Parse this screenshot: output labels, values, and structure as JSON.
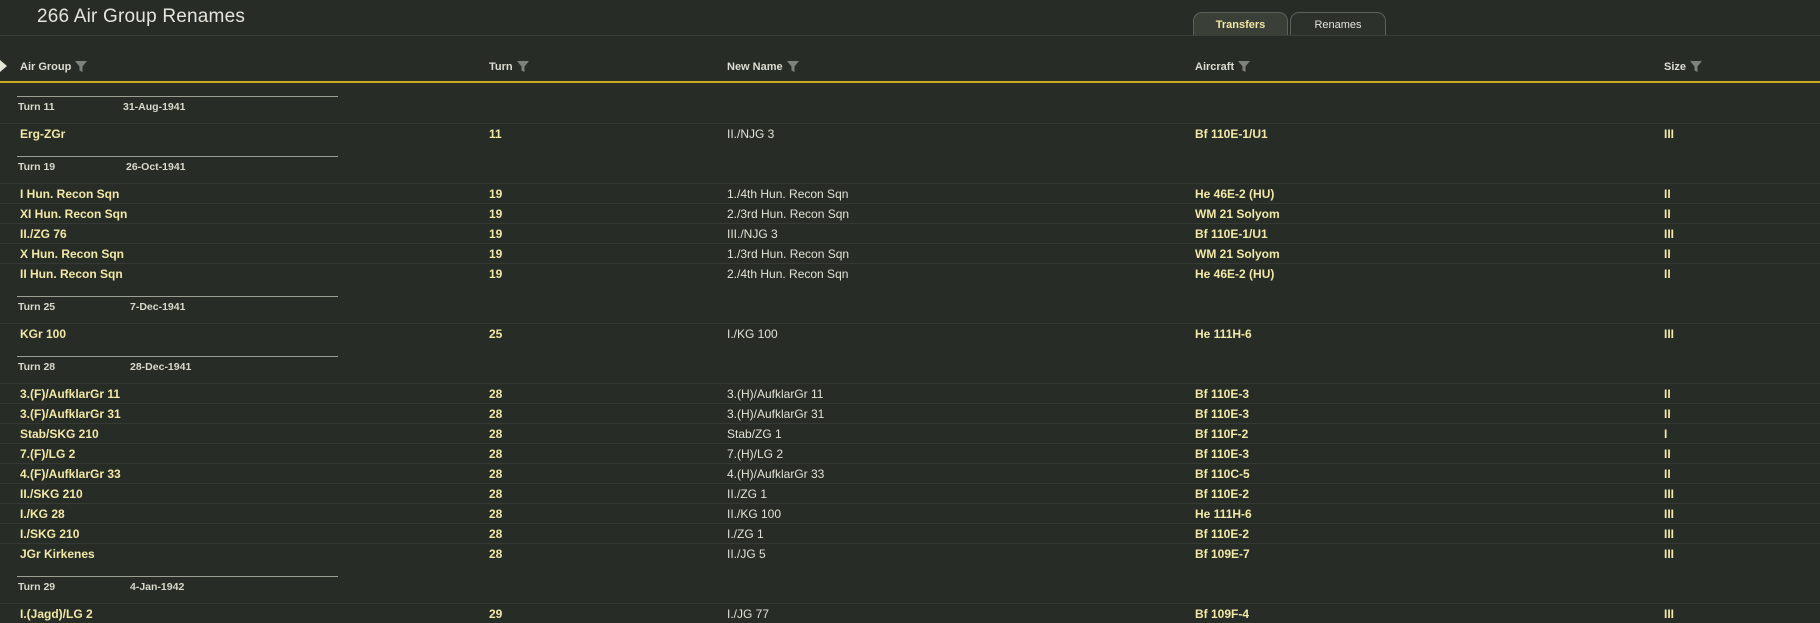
{
  "page": {
    "title": "266 Air Group Renames"
  },
  "tabs": [
    {
      "label": "Transfers",
      "active": false
    },
    {
      "label": "Renames",
      "active": true
    }
  ],
  "columns": {
    "air_group": "Air Group",
    "turn": "Turn",
    "new_name": "New Name",
    "aircraft": "Aircraft",
    "size": "Size"
  },
  "groups": [
    {
      "turn_label": "Turn 11",
      "date": "31-Aug-1941",
      "rows": [
        {
          "air_group": "Erg-ZGr",
          "turn": "11",
          "new_name": "II./NJG 3",
          "aircraft": "Bf 110E-1/U1",
          "size": "III"
        }
      ]
    },
    {
      "turn_label": "Turn 19",
      "date": "26-Oct-1941",
      "rows": [
        {
          "air_group": "I Hun. Recon Sqn",
          "turn": "19",
          "new_name": "1./4th Hun. Recon Sqn",
          "aircraft": "He 46E-2 (HU)",
          "size": "II"
        },
        {
          "air_group": "XI Hun. Recon Sqn",
          "turn": "19",
          "new_name": "2./3rd Hun. Recon Sqn",
          "aircraft": "WM 21 Solyom",
          "size": "II"
        },
        {
          "air_group": "II./ZG 76",
          "turn": "19",
          "new_name": "III./NJG 3",
          "aircraft": "Bf 110E-1/U1",
          "size": "III"
        },
        {
          "air_group": "X Hun. Recon Sqn",
          "turn": "19",
          "new_name": "1./3rd Hun. Recon Sqn",
          "aircraft": "WM 21 Solyom",
          "size": "II"
        },
        {
          "air_group": "II Hun. Recon Sqn",
          "turn": "19",
          "new_name": "2./4th Hun. Recon Sqn",
          "aircraft": "He 46E-2 (HU)",
          "size": "II"
        }
      ]
    },
    {
      "turn_label": "Turn 25",
      "date": "7-Dec-1941",
      "rows": [
        {
          "air_group": "KGr 100",
          "turn": "25",
          "new_name": "I./KG 100",
          "aircraft": "He 111H-6",
          "size": "III"
        }
      ]
    },
    {
      "turn_label": "Turn 28",
      "date": "28-Dec-1941",
      "rows": [
        {
          "air_group": "3.(F)/AufklarGr 11",
          "turn": "28",
          "new_name": "3.(H)/AufklarGr 11",
          "aircraft": "Bf 110E-3",
          "size": "II"
        },
        {
          "air_group": "3.(F)/AufklarGr 31",
          "turn": "28",
          "new_name": "3.(H)/AufklarGr 31",
          "aircraft": "Bf 110E-3",
          "size": "II"
        },
        {
          "air_group": "Stab/SKG 210",
          "turn": "28",
          "new_name": "Stab/ZG 1",
          "aircraft": "Bf 110F-2",
          "size": "I"
        },
        {
          "air_group": "7.(F)/LG 2",
          "turn": "28",
          "new_name": "7.(H)/LG 2",
          "aircraft": "Bf 110E-3",
          "size": "II"
        },
        {
          "air_group": "4.(F)/AufklarGr 33",
          "turn": "28",
          "new_name": "4.(H)/AufklarGr 33",
          "aircraft": "Bf 110C-5",
          "size": "II"
        },
        {
          "air_group": "II./SKG 210",
          "turn": "28",
          "new_name": "II./ZG 1",
          "aircraft": "Bf 110E-2",
          "size": "III"
        },
        {
          "air_group": "I./KG 28",
          "turn": "28",
          "new_name": "II./KG 100",
          "aircraft": "He 111H-6",
          "size": "III"
        },
        {
          "air_group": "I./SKG 210",
          "turn": "28",
          "new_name": "I./ZG 1",
          "aircraft": "Bf 110E-2",
          "size": "III"
        },
        {
          "air_group": "JGr Kirkenes",
          "turn": "28",
          "new_name": "II./JG 5",
          "aircraft": "Bf 109E-7",
          "size": "III"
        }
      ]
    },
    {
      "turn_label": "Turn 29",
      "date": "4-Jan-1942",
      "rows": [
        {
          "air_group": "I.(Jagd)/LG 2",
          "turn": "29",
          "new_name": "I./JG 77",
          "aircraft": "Bf 109F-4",
          "size": "III"
        }
      ]
    }
  ],
  "colors": {
    "background": "#272c27",
    "accent": "#c8a920",
    "value_text": "#f2e8a6"
  },
  "icons": {
    "filter": "funnel-icon",
    "expand": "triangle-right-icon"
  }
}
